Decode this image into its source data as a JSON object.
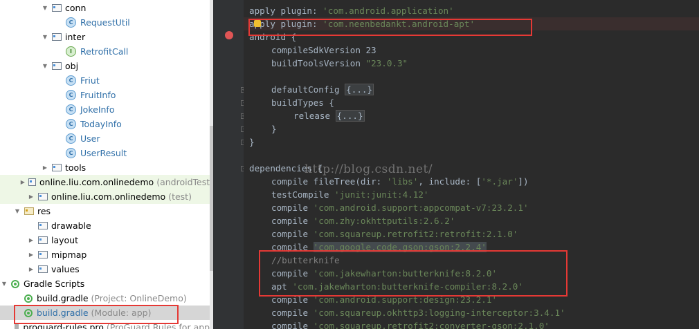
{
  "project_tree": {
    "items": [
      {
        "label": "conn",
        "type": "folder",
        "expand": "open",
        "indent": 1
      },
      {
        "label": "RequestUtil",
        "type": "class",
        "indent": 2
      },
      {
        "label": "inter",
        "type": "folder",
        "expand": "open",
        "indent": 1
      },
      {
        "label": "RetrofitCall",
        "type": "interface",
        "indent": 2
      },
      {
        "label": "obj",
        "type": "folder",
        "expand": "open",
        "indent": 1
      },
      {
        "label": "Friut",
        "type": "class",
        "indent": 2
      },
      {
        "label": "FruitInfo",
        "type": "class",
        "indent": 2
      },
      {
        "label": "JokeInfo",
        "type": "class",
        "indent": 2
      },
      {
        "label": "TodayInfo",
        "type": "class",
        "indent": 2
      },
      {
        "label": "User",
        "type": "class",
        "indent": 2
      },
      {
        "label": "UserResult",
        "type": "class",
        "indent": 2
      },
      {
        "label": "tools",
        "type": "folder",
        "expand": "closed",
        "indent": 1
      },
      {
        "label": "online.liu.com.onlinedemo",
        "suffix": "(androidTest)",
        "type": "package",
        "expand": "closed",
        "indent": 0,
        "row_style": "green"
      },
      {
        "label": "online.liu.com.onlinedemo",
        "suffix": "(test)",
        "type": "package",
        "expand": "closed",
        "indent": 0,
        "row_style": "green"
      },
      {
        "label": "res",
        "type": "res-folder",
        "expand": "open",
        "indent": -1
      },
      {
        "label": "drawable",
        "type": "folder",
        "expand": "none",
        "indent": 0
      },
      {
        "label": "layout",
        "type": "folder",
        "expand": "closed",
        "indent": 0
      },
      {
        "label": "mipmap",
        "type": "folder",
        "expand": "closed",
        "indent": 0
      },
      {
        "label": "values",
        "type": "folder",
        "expand": "closed",
        "indent": 0
      },
      {
        "label": "Gradle Scripts",
        "type": "gradle",
        "expand": "open",
        "indent": -2
      },
      {
        "label": "build.gradle",
        "suffix": "(Project: OnlineDemo)",
        "type": "gradle",
        "expand": "none",
        "indent": -1
      },
      {
        "label": "build.gradle",
        "suffix": "(Module: app)",
        "type": "gradle",
        "expand": "none",
        "indent": -1,
        "row_style": "sel"
      },
      {
        "label": "proguard-rules.pro",
        "suffix": "(ProGuard Rules for app)",
        "type": "proguard",
        "expand": "none",
        "indent": -1
      }
    ]
  },
  "editor": {
    "lines": [
      {
        "indent": 0,
        "parts": [
          {
            "t": "apply plugin: ",
            "c": ""
          },
          {
            "t": "'com.android.application'",
            "c": "str"
          }
        ]
      },
      {
        "indent": 0,
        "parts": [
          {
            "t": "apply plugin: ",
            "c": ""
          },
          {
            "t": "'com.neenbedankt.android-apt'",
            "c": "str"
          }
        ],
        "highlight": true
      },
      {
        "indent": 0,
        "parts": [
          {
            "t": "android {",
            "c": ""
          }
        ]
      },
      {
        "indent": 1,
        "parts": [
          {
            "t": "compileSdkVersion 23",
            "c": ""
          }
        ]
      },
      {
        "indent": 1,
        "parts": [
          {
            "t": "buildToolsVersion ",
            "c": ""
          },
          {
            "t": "\"23.0.3\"",
            "c": "str"
          }
        ]
      },
      {
        "indent": 0,
        "parts": []
      },
      {
        "indent": 1,
        "parts": [
          {
            "t": "defaultConfig ",
            "c": ""
          },
          {
            "t": "{...}",
            "c": "fold"
          }
        ]
      },
      {
        "indent": 1,
        "parts": [
          {
            "t": "buildTypes {",
            "c": ""
          }
        ]
      },
      {
        "indent": 2,
        "parts": [
          {
            "t": "release ",
            "c": ""
          },
          {
            "t": "{...}",
            "c": "fold"
          }
        ]
      },
      {
        "indent": 1,
        "parts": [
          {
            "t": "}",
            "c": ""
          }
        ]
      },
      {
        "indent": 0,
        "parts": [
          {
            "t": "}",
            "c": ""
          }
        ]
      },
      {
        "indent": 0,
        "parts": []
      },
      {
        "indent": 0,
        "parts": [
          {
            "t": "dependencies {",
            "c": ""
          }
        ]
      },
      {
        "indent": 1,
        "parts": [
          {
            "t": "compile fileTree(",
            "c": ""
          },
          {
            "t": "dir: ",
            "c": ""
          },
          {
            "t": "'libs'",
            "c": "str"
          },
          {
            "t": ", include: [",
            "c": ""
          },
          {
            "t": "'*.jar'",
            "c": "str"
          },
          {
            "t": "])",
            "c": ""
          }
        ]
      },
      {
        "indent": 1,
        "parts": [
          {
            "t": "testCompile ",
            "c": ""
          },
          {
            "t": "'junit:junit:4.12'",
            "c": "str"
          }
        ]
      },
      {
        "indent": 1,
        "parts": [
          {
            "t": "compile ",
            "c": ""
          },
          {
            "t": "'com.android.support:appcompat-v7:23.2.1'",
            "c": "str"
          }
        ]
      },
      {
        "indent": 1,
        "parts": [
          {
            "t": "compile ",
            "c": ""
          },
          {
            "t": "'com.zhy:okhttputils:2.6.2'",
            "c": "str"
          }
        ]
      },
      {
        "indent": 1,
        "parts": [
          {
            "t": "compile ",
            "c": ""
          },
          {
            "t": "'com.squareup.retrofit2:retrofit:2.1.0'",
            "c": "str"
          }
        ]
      },
      {
        "indent": 1,
        "parts": [
          {
            "t": "compile ",
            "c": ""
          },
          {
            "t": "'com.google.code.gson:gson:2.2.4'",
            "c": "str-sel"
          }
        ]
      },
      {
        "indent": 1,
        "parts": [
          {
            "t": "//butterknife",
            "c": "comment"
          }
        ]
      },
      {
        "indent": 1,
        "parts": [
          {
            "t": "compile ",
            "c": ""
          },
          {
            "t": "'com.jakewharton:butterknife:8.2.0'",
            "c": "str"
          }
        ]
      },
      {
        "indent": 1,
        "parts": [
          {
            "t": "apt ",
            "c": ""
          },
          {
            "t": "'com.jakewharton:butterknife-compiler:8.2.0'",
            "c": "str"
          }
        ]
      },
      {
        "indent": 1,
        "parts": [
          {
            "t": "compile ",
            "c": ""
          },
          {
            "t": "'com.android.support:design:23.2.1'",
            "c": "str"
          }
        ]
      },
      {
        "indent": 1,
        "parts": [
          {
            "t": "compile ",
            "c": ""
          },
          {
            "t": "'com.squareup.okhttp3:logging-interceptor:3.4.1'",
            "c": "str"
          }
        ]
      },
      {
        "indent": 1,
        "parts": [
          {
            "t": "compile ",
            "c": ""
          },
          {
            "t": "'com.squareup.retrofit2:converter-gson:2.1.0'",
            "c": "str"
          }
        ]
      }
    ]
  },
  "watermark": "http://blog.csdn.net/",
  "icons": {
    "folder": "folder-icon",
    "class": "class-icon",
    "interface": "interface-icon",
    "gradle": "gradle-icon",
    "breakpoint": "breakpoint-icon",
    "bulb": "intention-bulb-icon"
  },
  "colors": {
    "annotation_box": "#e53935",
    "string": "#6a8759",
    "editor_bg": "#2b2b2b"
  }
}
